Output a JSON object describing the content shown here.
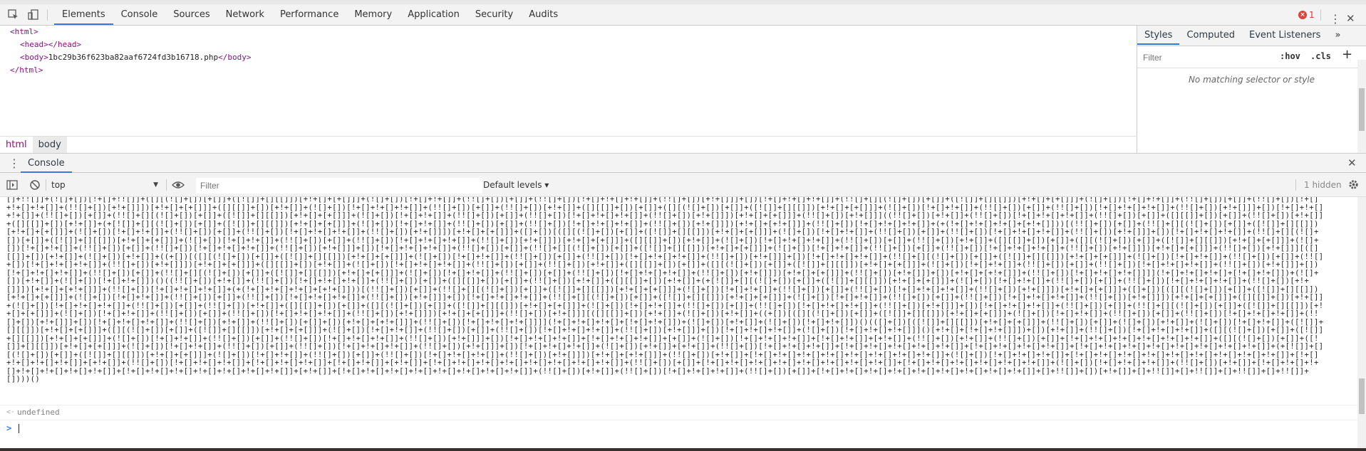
{
  "devtools": {
    "tabs": [
      "Elements",
      "Console",
      "Sources",
      "Network",
      "Performance",
      "Memory",
      "Application",
      "Security",
      "Audits"
    ],
    "active_tab": "Elements",
    "error_count": "1"
  },
  "elements": {
    "html_open": "<html>",
    "head": "<head></head>",
    "body_open": "<body>",
    "body_text": "1bc29b36f623ba82aaf6724fd3b16718.php",
    "body_close": "</body>",
    "html_close": "</html>",
    "breadcrumbs": [
      "html",
      "body"
    ]
  },
  "styles": {
    "tabs": [
      "Styles",
      "Computed",
      "Event Listeners"
    ],
    "more": "»",
    "filter_placeholder": "Filter",
    "hov": ":hov",
    "cls": ".cls",
    "plus": "+",
    "empty_message": "No matching selector or style"
  },
  "drawer": {
    "tab": "Console"
  },
  "console": {
    "context": "top",
    "filter_placeholder": "Filter",
    "levels": "Default levels ▾",
    "hidden": "1 hidden",
    "jsfuck": "[]+!![]]+(![]+[])[!+[]+!![]]+([][(![]+[])[+[]]+([![]]+[][[]])[+!+[]+[+[]]]+(![]+[])[!+[]+!+[]]+(!![]+[])[+[]]+(!![]+[])[!+[]+!+[]+!+[]]+(!![]+[])[+!+[]]]+[])[!+[]+!+[]+!+[]]+(!![]+[][(![]+[])[+[]]+([![]]+[][[]])[+!+[]+[+[]]]+(![]+[])[!+[]+!+[]]+(!![]+[])[+[]]+(!![]+[])[!+[]+!+[]+!+[]]+(!![]+[])[+!+[]]])[+!+[]+[+[]]]+([][[]]+[])[+!+[]]+(![]+[])[!+[]+!+[]+!+[]]+(!![]+[])[+[]]+(!![]+[])[+!+[]]+([][[]]+[])[+[]]+([][(![]+[])[+[]]+([![]]+[][[]])[+!+[]+[+[]]]+(![]+[])[!+[]+!+[]]+(!![]+[])[+[]]+(!![]+[])[!+[]+!+[]+!+[]]+(!![]+[])[+!+[]]]+[])[!+[]+!+[]+!+[]]+(!![]+[])[+[]]+(!![]+[][(![]+[])[+[]]+([![]]+[][[]])[+!+[]+[+[]]]+(![]+[])[!+[]+!+[]]+(!![]+[])[+[]]+(!![]+[])[!+[]+!+[]+!+[]]+(!![]+[])[+!+[]]])[+!+[]+[+[]]]+(!![]+[])[+!+[]]]((!![]+[])[+!+[]]+(!![]+[])[!+[]+!+[]+!+[]]+(!![]+[])[+[]]+([][[]]+[])[+[]]+(!![]+[])[+!+[]]+([][[]]+[])[+!+[]]+(+[![]]+[][(![]+[])[+[]]+([![]]+[][[]])[+!+[]+[+[]]]+(![]+[])[!+[]+!+[]]+(!![]+[])[+[]]+(!![]+[])[!+[]+!+[]+!+[]]+(!![]+[])[+!+[]]])[+!+[]+[+!+[]]]+(!![]+[])[!+[]+!+[]+!+[]]+(+(!+[]+!+[]+!+[]+[+!+[]]))[(!![]+[])[+[]]+(!![]+[][(![]+[])[+[]]+([![]]+[][[]])[+!+[]+[+[]]]+(![]+[])[!+[]+!+[]]+(!![]+[])[+[]]+(!![]+[])[!+[]+!+[]+!+[]]+(!![]+[])[+!+[]]])[+!+[]+[+[]]]+([]+[])[([][(![]+[])[+[]]+([![]]+[][[]])[+!+[]+[+[]]]+(![]+[])[!+[]+!+[]]+(!![]+[])[+[]]+(!![]+[])[!+[]+!+[]+!+[]]+(!![]+[])[+!+[]]]+[])[!+[]+!+[]+!+[]]+(!![]+[][(![]+[])[+[]]+([![]]+[][[]])[+!+[]+[+[]]]+(![]+[])[!+[]+!+[]]+(!![]+[])[+[]]+(!![]+[])[!+[]+!+[]+!+[]]+(!![]+[])[+!+[]]])[+!+[]+[+[]]]+([][[]]+[])[+!+[]]+(![]+[])[!+[]+!+[]+!+[]]+(!![]+[])[+[]]+(!![]+[])[+!+[]]+([][[]]+[])[+[]]+([][(![]+[])[+[]]+([![]]+[][[]])[+!+[]+[+[]]]+(![]+[])[!+[]+!+[]]+(!![]+[])[+[]]+(!![]+[])[!+[]+!+[]+!+[]]+(!![]+[])[+!+[]]]+[])[!+[]+!+[]+!+[]]+(!![]+[])[+[]]+(!![]+[][(![]+[])[+[]]+([![]]+[][[]])[+!+[]+[+[]]]+(![]+[])[!+[]+!+[]]+(!![]+[])[+[]]+(!![]+[])[!+[]+!+[]+!+[]]+(!![]+[])[+!+[]]])[+!+[]+[+[]]]+(!![]+[])[+!+[]]][([][[]]+[])[+!+[]]+(![]+[])[+!+[]]+((+[])[([][(![]+[])[+[]]+([![]]+[][[]])[+!+[]+[+[]]]+(![]+[])[!+[]+!+[]]+(!![]+[])[+[]]+(!![]+[])[!+[]+!+[]+!+[]]+(!![]+[])[+!+[]]]+[])[!+[]+!+[]+!+[]]+(!![]+[][(![]+[])[+[]]+([![]]+[][[]])[+!+[]+[+[]]]+(![]+[])[!+[]+!+[]]+(!![]+[])[+[]]+(!![]+[])[!+[]+!+[]+!+[]]+(!![]+[])[+!+[]]])[+!+[]+[+[]]]+([][[]]+[])[+!+[]]+(![]+[])[!+[]+!+[]+!+[]]+(!![]+[])[+[]]+(!![]+[])[+!+[]]+([][[]]+[])[+[]]+([][(![]+[])[+[]]+([![]]+[][[]])[+!+[]+[+[]]]+(![]+[])[!+[]+!+[]]+(!![]+[])[+[]]+(!![]+[])[!+[]+!+[]+!+[]]+(!![]+[])[+!+[]]]+[])[!+[]+!+[]+!+[]]+(!![]+[])[+[]]+(!![]+[][(![]+[])[+[]]+([![]]+[][[]])[+!+[]+[+[]]]+(![]+[])[!+[]+!+[]]+(!![]+[])[+[]]+(!![]+[])[!+[]+!+[]+!+[]]+(!![]+[])[+!+[]]])[+!+[]+[+[]]]+(!![]+[])[+!+[]]]+[])[+!+[]+[+!+[]]]+(!![]+[])[!+[]+!+[]+!+[]]]](!+[]+!+[]+!+[]+[!+[]+!+[]])+(![]+[])[+!+[]]+(![]+[])[!+[]+!+[]])()((!![]+[])[+!+[]]+(!![]+[])[!+[]+!+[]+!+[]]+(!![]+[])[+[]]+([][[]]+[])[+[]]+(!![]+[])[+!+[]]+([][[]]+[])[+!+[]]+(+[![]]+[][(![]+[])[+[]]+([![]]+[][[]])[+!+[]+[+[]]]+(![]+[])[!+[]+!+[]]+(!![]+[])[+[]]+(!![]+[])[!+[]+!+[]+!+[]]+(!![]+[])[+!+[]]])[+!+[]+[+!+[]]]+(!![]+[])[!+[]+!+[]+!+[]]+(+(!+[]+!+[]+!+[]+[+!+[]]))[(!![]+[])[+[]]+(!![]+[][(![]+[])[+[]]+([![]]+[][[]])[+!+[]+[+[]]]+(![]+[])[!+[]+!+[]]+(!![]+[])[+[]]+(!![]+[])[!+[]+!+[]+!+[]]+(!![]+[])[+!+[]]])[+!+[]+[+[]]]+([]+[])[([][(![]+[])[+[]]+([![]]+[][[]])[+!+[]+[+[]]]+(![]+[])[!+[]+!+[]]+(!![]+[])[+[]]+(!![]+[])[!+[]+!+[]+!+[]]+(!![]+[])[+!+[]]]+[])[!+[]+!+[]+!+[]]+(!![]+[][(![]+[])[+[]]+([![]]+[][[]])[+!+[]+[+[]]]+(![]+[])[!+[]+!+[]]+(!![]+[])[+[]]+(!![]+[])[!+[]+!+[]+!+[]]+(!![]+[])[+!+[]]])[+!+[]+[+[]]]+([][[]]+[])[+!+[]]+(![]+[])[!+[]+!+[]+!+[]]+(!![]+[])[+[]]+(!![]+[])[+!+[]]+([][[]]+[])[+[]]+([][(![]+[])[+[]]+([![]]+[][[]])[+!+[]+[+[]]]+(![]+[])[!+[]+!+[]]+(!![]+[])[+[]]+(!![]+[])[!+[]+!+[]+!+[]]+(!![]+[])[+!+[]]]+[])[!+[]+!+[]+!+[]]+(!![]+[])[+[]]+(!![]+[][(![]+[])[+[]]+([![]]+[][[]])[+!+[]+[+[]]]+(![]+[])[!+[]+!+[]]+(!![]+[])[+[]]+(!![]+[])[!+[]+!+[]+!+[]]+(!![]+[])[+!+[]]])[+!+[]+[+[]]]+(!![]+[])[+!+[]]][([][[]]+[])[+!+[]]+(![]+[])[+!+[]]+((+[])[([][(![]+[])[+[]]+([![]]+[][[]])[+!+[]+[+[]]]+(![]+[])[!+[]+!+[]]+(!![]+[])[+[]]+(!![]+[])[!+[]+!+[]+!+[]]+(!![]+[])[+!+[]]]+[])[!+[]+!+[]+!+[]]+(!![]+[])[+!+[]]+(!![]+[])[+[]]+[])[+!+[]+[+!+[]]]+(!![]+[])[!+[]+!+[]+!+[]]]](!+[]+!+[]+!+[]+[!+[]+!+[]])+(![]+[])[+!+[]]+(![]+[])[!+[]+!+[]])()(([]+[])[([![]]+[][[]])[+!+[]+[+[]]]+(!![]+[])[+[]]+(![]+[])[+!+[]]+(![]+[])[!+[]+!+[]]+([![]]+[][[]])[+!+[]+[+[]]]+([][(![]+[])[+[]]+([![]]+[][[]])[+!+[]+[+[]]]+(![]+[])[!+[]+!+[]]+(!![]+[])[+[]]+(!![]+[])[!+[]+!+[]+!+[]]+(!![]+[])[+!+[]]]+[])[!+[]+!+[]+!+[]]+(![]+[])[!+[]+!+[]+!+[]]]()[+!+[]+[!+[]+!+[]]])+[])[+!+[]]+(!![]+[])[!+[]+!+[]+!+[]]+([][(![]+[])[+[]]+([![]]+[][[]])[+!+[]+[+[]]]+(![]+[])[!+[]+!+[]]+(!![]+[])[+[]]+(!![]+[])[!+[]+!+[]+!+[]]+(!![]+[])[+!+[]]]+[])[!+[]+!+[]+!+[]]+[!+[]+!+[]+!+[]]+[+[]]+(![]+[])[!+[]+!+[]+!+[]]+[!+[]+!+[]]+[+!+[]]+(!![]+[])[+!+[]]+(!![]+[])[+[]]+[!+[]+!+[]+!+[]+!+[]+!+[]+!+[]]+([][(![]+[])[+[]]+([![]]+[][[]])[+!+[]+[+[]]]+(![]+[])[!+[]+!+[]]+(!![]+[])[+[]]+(!![]+[])[!+[]+!+[]+!+[]]+(!![]+[])[+!+[]]]+[])[!+[]+!+[]+!+[]]+(![]+[])[+!+[]]+[+!+[]]+(!![]+[])[!+[]+!+[]+!+[]]+[!+[]+!+[]+!+[]+!+[]+!+[]]+[!+[]+!+[]+!+[]+!+[]]+[!+[]+!+[]+!+[]+!+[]+!+[]+!+[]+!+[]+!+[]]+(+[![]]+[][(![]+[])[+[]]+([![]]+[][[]])[+!+[]+[+[]]]+(![]+[])[!+[]+!+[]]+(!![]+[])[+[]]+(!![]+[])[!+[]+!+[]+!+[]]+(!![]+[])[+!+[]]])[+!+[]+[+!+[]]]+(!![]+[])[+!+[]]+[!+[]+!+[]+!+[]+!+[]+!+[]+!+[]+!+[]+!+[]]+(![]+[])[!+[]+!+[]+!+[]]+[!+[]+!+[]+!+[]+!+[]+!+[]+!+[]+!+[]+!+[]+!+[]]+[!+[]+!+[]+!+[]+!+[]]+[+!+[]]+(!![]+[])[!+[]+!+[]+!+[]]+[!+[]+!+[]+!+[]]+[!+[]+!+[]]+[+!+[]]+[!+[]+!+[]+!+[]+!+[]+!+[]+!+[]+!+[]+!+[]]+(!![]+[])[+[]]+[!+[]+!+[]+!+[]+!+[]+!+[]+!+[]+!+[]+!+[]]+[!+[]+!+[]+!+[]+!+[]+!+[]+!+[]]+(![]+[])[!+[]+!+[]+!+[]]+(!![]+[])[+!+[]]+[!+[]+!+[]+!+[]+!+[]+!+[]+!+[]+!+[]]+[!+[]+!+[]+!+[]+!+[]+!+[]+!+[]+!+[]]+[+!+[]]+[!+[]+!+[]+!+[]+!+[]+!+[]+!+[]+!+[]+!+[]]+(!![]+[])[+!+[]]+(!![]+[])[!+[]+!+[]+!+[]]+(!![]+[])[+[]]+[!+[]+!+[]+!+[]+!+[]+!+[]+!+[]+!+[]+!+[]+!+[]]+[]+!![]]+[])[+!+[]]+[]+!![]]+[]+!![]]+[]+!![]]+[]+!![]]+[])))()",
    "result": "undefined"
  }
}
